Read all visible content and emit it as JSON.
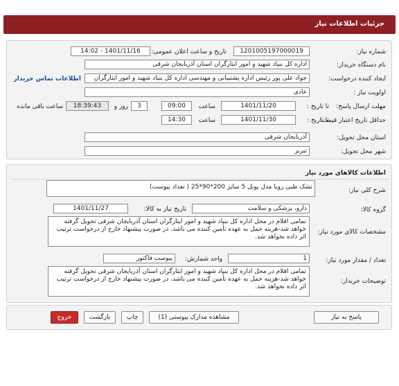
{
  "header": {
    "title": "جزئیات اطلاعات نیاز"
  },
  "info": {
    "need_number_label": "شماره نیاز:",
    "need_number": "1201005197000019",
    "announce_label": "تاریخ و ساعت اعلان عمومی:",
    "announce_value": "1401/11/16 - 14:02",
    "buyer_org_label": "نام دستگاه خریدار:",
    "buyer_org": "اداره کل بنیاد شهید و امور ایثارگران استان آذربایجان شرقی",
    "requester_label": "ایجاد کننده درخواست:",
    "requester": "جواد علی پور رئیس اداره پشتیبانی و مهندسی اداره کل بنیاد شهید و امور ایثارگران",
    "contact_link": "اطلاعات تماس خریدار",
    "priority_label": "اولویت نیاز :",
    "priority": "عادی",
    "reply_deadline_label": "مهلت ارسال پاسخ:",
    "to_date_label": "تا تاریخ :",
    "reply_date": "1401/11/20",
    "time_label": "ساعت",
    "reply_time": "09:00",
    "days_value": "3",
    "days_label": "روز و",
    "remaining_time": "18:39:43",
    "remaining_label": "ساعت باقی مانده",
    "price_validity_label": "حداقل تاریخ اعتبار قیمت:",
    "to_date_label2": "تا تاریخ :",
    "validity_date": "1401/11/30",
    "time_label2": "ساعت",
    "validity_time": "14:30",
    "delivery_province_label": "استان محل تحویل:",
    "delivery_province": "آذربایجان شرقی",
    "delivery_city_label": "شهر محل تحویل:",
    "delivery_city": "تبریز"
  },
  "goods": {
    "section_title": "اطلاعات کالاهای مورد نیاز",
    "summary_label": "شرح کلی نیاز:",
    "summary": "تشک طبی رویا مدل پونل 5 سایز 200*90*25 ( تعداد پیوست)",
    "group_label": "گروه کالا:",
    "group": "دارو، پزشکی و سلامت",
    "need_date_label": "تاریخ نیاز به کالا:",
    "need_date": "1401/11/27",
    "spec_label": "مشخصات کالای مورد نیاز:",
    "spec": "تمامی اقلام در محل اداره کل بنیاد شهید و امور ایثارگران استان آذربایجان شرقی تحویل گرفته خواهد شد-هزینه حمل به عهده تأمین کننده می باشد، در صورت پیشنهاد خارج از درخواست ترتیب اثر داده نخواهد شد.",
    "qty_label": "تعداد / مقدار مورد نیاز:",
    "qty": "1",
    "unit_label": "واحد شمارش:",
    "unit": "پیوست فاکتور",
    "buyer_notes_label": "توضیحات خریدار:",
    "buyer_notes": "تمامی اقلام در محل اداره کل بنیاد شهید و امور ایثارگران استان آذربایجان شرقی تحویل گرفته خواهد شد-هزینه حمل به عهده تأمین کننده می باشد، در صورت پیشنهاد خارج از درخواست ترتیب اثر داده نخواهد شد."
  },
  "actions": {
    "reply": "پاسخ به نیاز",
    "attachments": "مشاهده مدارک پیوستی (1)",
    "print": "چاپ",
    "back": "بازگشت",
    "exit": "خروج"
  },
  "colors": {
    "header_bg": "#8e1f23",
    "link": "#1b4f99",
    "exit_bg": "#c62c2c"
  }
}
